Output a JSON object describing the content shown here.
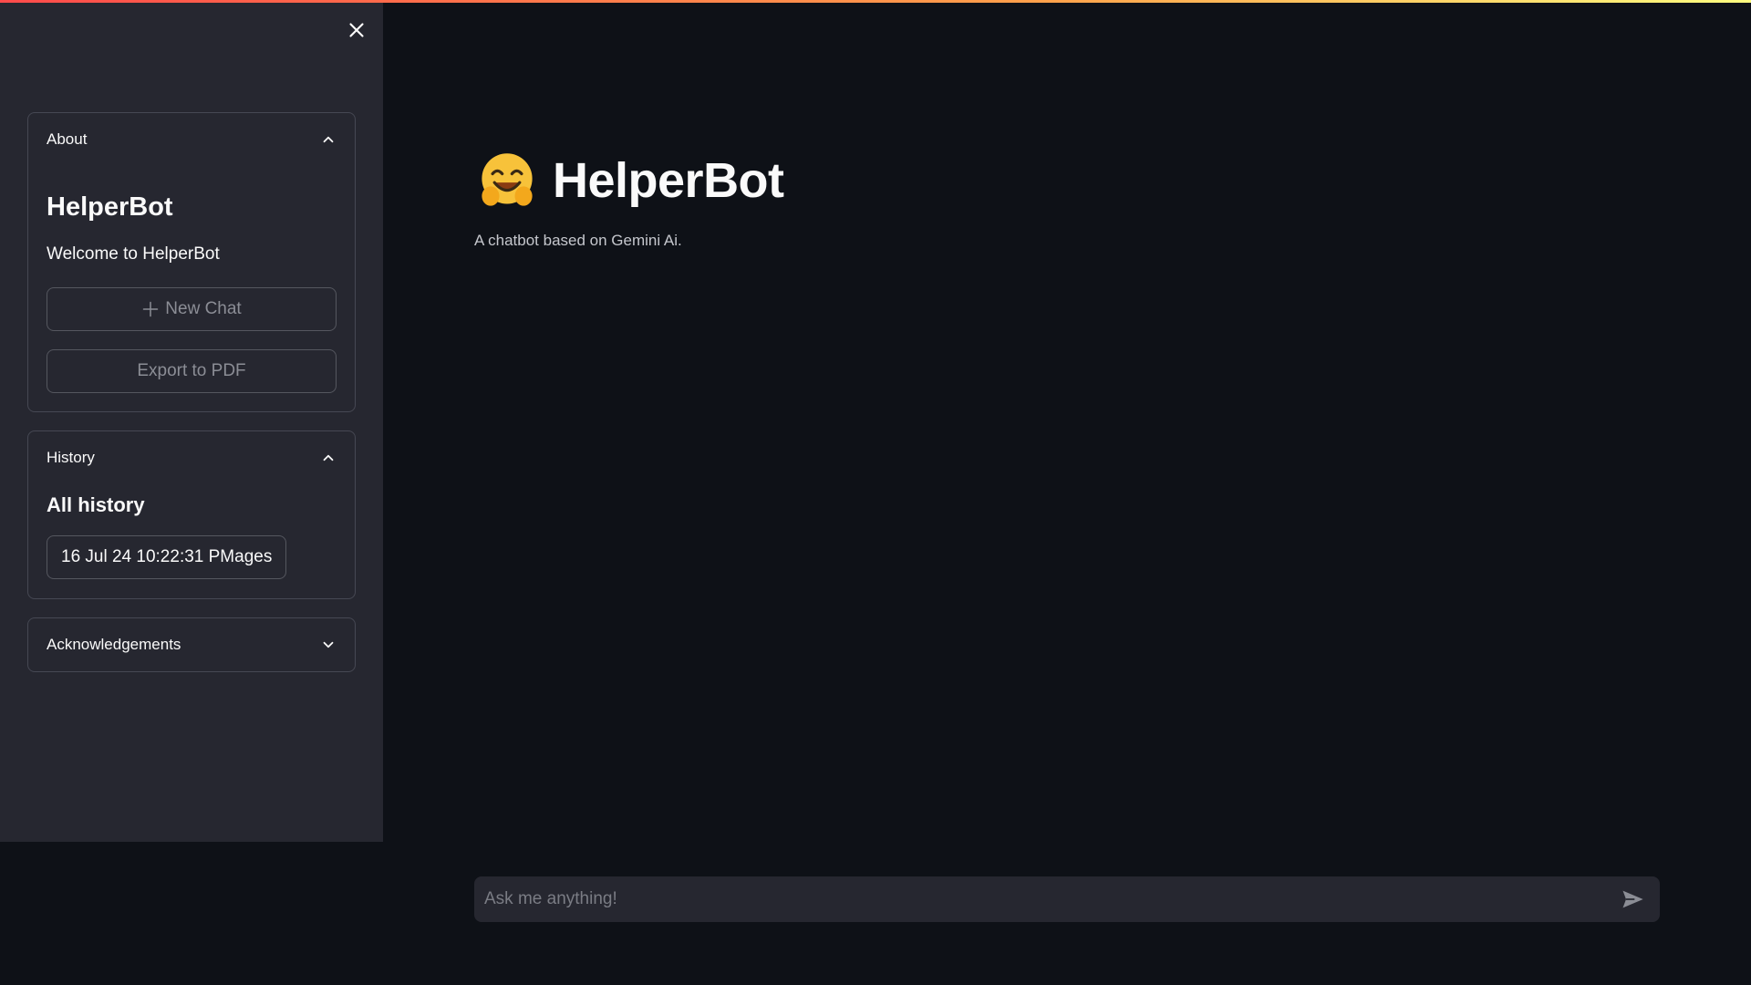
{
  "app": {
    "title": "HelperBot",
    "subtitle": "A chatbot based on Gemini Ai.",
    "logo_icon": "hugging-face-emoji"
  },
  "sidebar": {
    "close_icon": "close-icon",
    "about": {
      "header": "About",
      "expanded": true,
      "title": "HelperBot",
      "welcome": "Welcome to HelperBot",
      "new_chat_label": "New Chat",
      "export_label": "Export to PDF"
    },
    "history": {
      "header": "History",
      "expanded": true,
      "title": "All history",
      "items": [
        "16 Jul 24 10:22:31 PMages"
      ]
    },
    "acknowledgements": {
      "header": "Acknowledgements",
      "expanded": false
    }
  },
  "chat": {
    "placeholder": "Ask me anything!",
    "value": "",
    "send_icon": "send-icon"
  },
  "colors": {
    "background": "#0e1117",
    "sidebar": "#262730",
    "text": "#fafafa",
    "border": "#464853",
    "accent_gradient": [
      "#ff4b4b",
      "#ffa24b",
      "#fffd80"
    ]
  }
}
